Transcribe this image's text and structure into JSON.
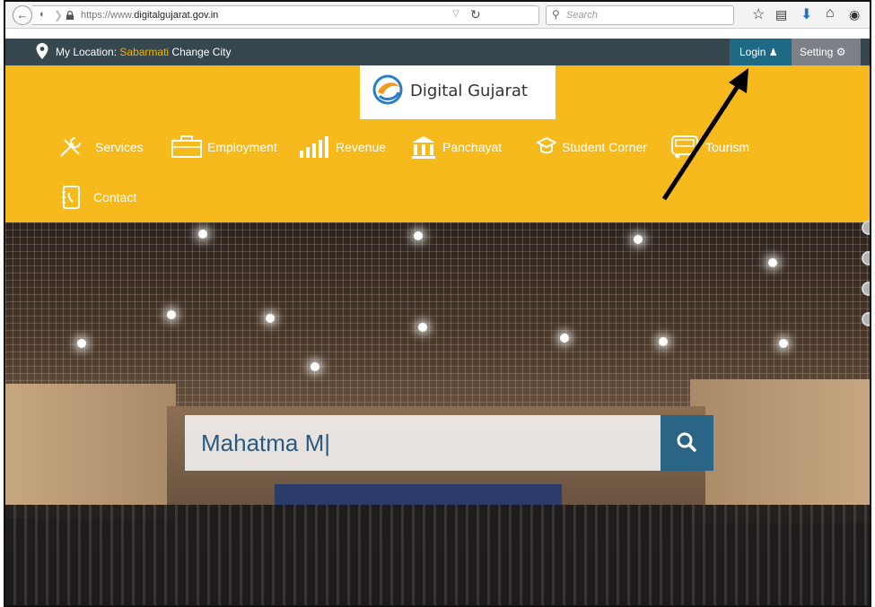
{
  "browser": {
    "url_prefix": "https://www.",
    "url_domain": "digitalgujarat.gov.in",
    "search_placeholder": "Search"
  },
  "topbar": {
    "location_label": "My Location:",
    "location_city": "Sabarmati",
    "change_city": "Change City",
    "login_label": "Login",
    "setting_label": "Setting"
  },
  "header": {
    "logo_text": "Digital Gujarat",
    "nav": [
      {
        "label": "Services"
      },
      {
        "label": "Employment"
      },
      {
        "label": "Revenue"
      },
      {
        "label": "Panchayat"
      },
      {
        "label": "Student Corner"
      },
      {
        "label": "Tourism"
      },
      {
        "label": "Contact"
      }
    ]
  },
  "hero": {
    "search_value": "Mahatma M|"
  },
  "colors": {
    "header_yellow": "#f7ba1c",
    "topbar_dark": "#37474f",
    "login_blue": "#1e6a84",
    "search_blue": "#2b6585"
  },
  "icons": [
    "back-arrow-icon",
    "shield-icon",
    "lock-icon",
    "reload-icon",
    "search-icon",
    "star-icon",
    "reading-list-icon",
    "download-icon",
    "home-icon",
    "chat-icon",
    "location-pin-icon",
    "user-icon",
    "gear-icon",
    "tools-icon",
    "briefcase-icon",
    "chart-icon",
    "bank-icon",
    "mortarboard-icon",
    "bus-icon",
    "phone-book-icon"
  ]
}
